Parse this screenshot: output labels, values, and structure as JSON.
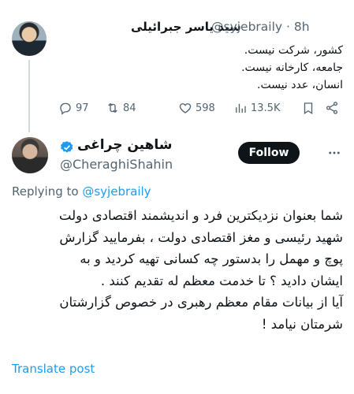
{
  "parent_tweet": {
    "author_name": "سید یاسر جبرائیلی",
    "author_handle": "@syjebraily",
    "time": "· 8h",
    "text_lines": [
      "کشور، شرکت نیست.",
      "جامعه، کارخانه نیست.",
      "انسان، عدد نیست."
    ],
    "actions": {
      "replies": "97",
      "retweets": "84",
      "likes": "598",
      "views": "13.5K"
    }
  },
  "reply_tweet": {
    "author_name": "شاهین چراغی",
    "author_handle": "@CheraghiShahin",
    "follow_label": "Follow",
    "replying_prefix": "Replying to",
    "replying_mention": "@syjebraily",
    "text_lines": [
      "شما بعنوان نزدیکترین فرد و اندیشمند اقتصادی دولت",
      "شهید رئیسی و مغز اقتصادی دولت ، بفرمایید گزارش",
      "پوچ و مهمل را بدستور چه کسانی تهیه کردید و به",
      "ایشان دادید ؟ تا خدمت معظم له تقدیم کنند .",
      "آیا از بیانات مقام معظم رهبری در خصوص گزارشتان",
      "شرمتان نیامد !"
    ],
    "translate_label": "Translate post"
  },
  "colors": {
    "accent": "#1d9bf0",
    "text": "#0f1419",
    "secondary": "#536471",
    "verified": "#1d9bf0"
  },
  "icons": [
    "reply-icon",
    "retweet-icon",
    "like-icon",
    "views-icon",
    "bookmark-icon",
    "share-icon",
    "verified-badge-icon",
    "more-options-icon"
  ]
}
